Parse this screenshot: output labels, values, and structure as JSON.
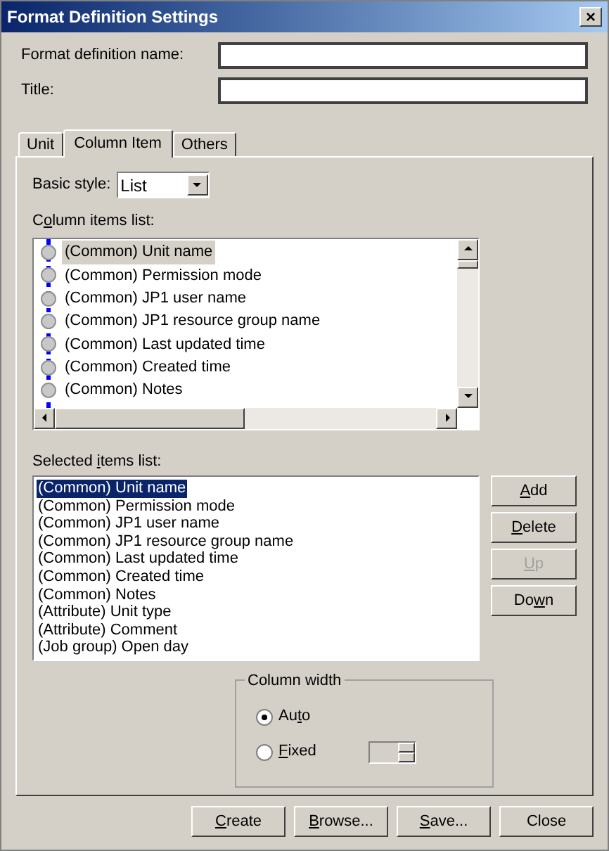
{
  "window": {
    "title": "Format Definition Settings",
    "close": "×"
  },
  "fields": [
    {
      "label": "Format definition name:"
    },
    {
      "label": "Title:"
    }
  ],
  "tabs": [
    {
      "label": "Unit",
      "selected": false
    },
    {
      "label": "Column Item",
      "selected": true
    },
    {
      "label": "Others",
      "selected": false
    }
  ],
  "basic_style": {
    "label": "Basic style:",
    "value": "List"
  },
  "column_items": {
    "label": {
      "pre": "C",
      "key": "o",
      "post": "lumn items list:"
    },
    "items": [
      {
        "text": "(Common) Unit name",
        "selected": true
      },
      {
        "text": "(Common) Permission mode",
        "selected": false
      },
      {
        "text": "(Common) JP1 user name",
        "selected": false
      },
      {
        "text": "(Common) JP1 resource group name",
        "selected": false
      },
      {
        "text": "(Common) Last updated time",
        "selected": false
      },
      {
        "text": "(Common) Created time",
        "selected": false
      },
      {
        "text": "(Common) Notes",
        "selected": false
      }
    ]
  },
  "selected_items": {
    "label": {
      "pre": "Selected ",
      "key": "i",
      "post": "tems list:"
    },
    "items": [
      {
        "text": "(Common) Unit name",
        "selected": true
      },
      {
        "text": "(Common) Permission mode",
        "selected": false
      },
      {
        "text": "(Common) JP1 user name",
        "selected": false
      },
      {
        "text": "(Common) JP1 resource group name",
        "selected": false
      },
      {
        "text": "(Common) Last updated time",
        "selected": false
      },
      {
        "text": "(Common) Created time",
        "selected": false
      },
      {
        "text": "(Common) Notes",
        "selected": false
      },
      {
        "text": "(Attribute) Unit type",
        "selected": false
      },
      {
        "text": "(Attribute) Comment",
        "selected": false
      },
      {
        "text": "(Job group) Open day",
        "selected": false
      }
    ]
  },
  "side_buttons": [
    {
      "label": {
        "key": "A",
        "post": "dd"
      },
      "disabled": false
    },
    {
      "label": {
        "key": "D",
        "post": "elete"
      },
      "disabled": false
    },
    {
      "label": {
        "key": "U",
        "post": "p"
      },
      "disabled": true
    },
    {
      "label": {
        "pre": "Do",
        "key": "w",
        "post": "n"
      },
      "disabled": false
    }
  ],
  "column_width": {
    "title": "Column width",
    "options": [
      {
        "label": {
          "pre": "Au",
          "key": "t",
          "post": "o"
        },
        "selected": true
      },
      {
        "label": {
          "key": "F",
          "post": "ixed"
        },
        "selected": false
      }
    ]
  },
  "bottom_buttons": [
    {
      "label": {
        "key": "C",
        "post": "reate"
      }
    },
    {
      "label": {
        "key": "B",
        "post": "rowse..."
      }
    },
    {
      "label": {
        "key": "S",
        "post": "ave..."
      }
    },
    {
      "label": "Close"
    }
  ]
}
